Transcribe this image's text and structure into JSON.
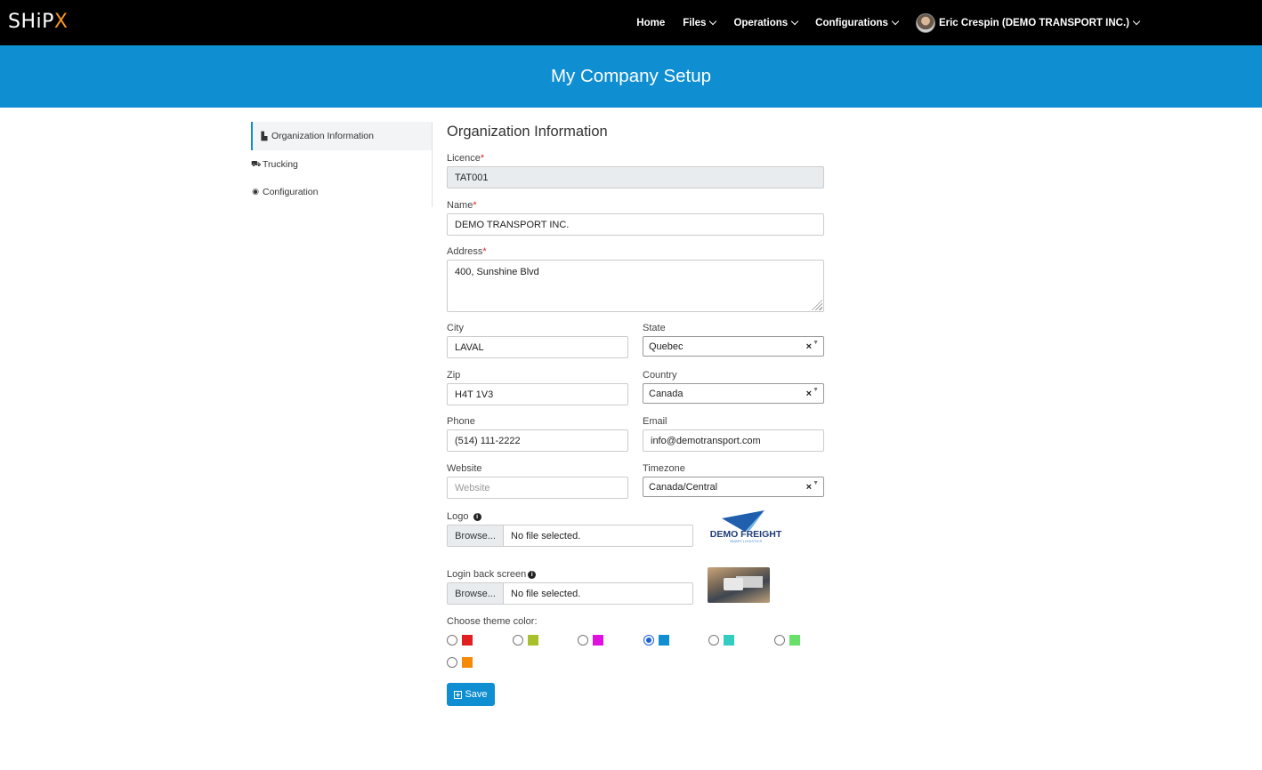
{
  "nav": {
    "brand_main": "SHiP",
    "brand_x": "X",
    "items": [
      {
        "label": "Home",
        "has_caret": false
      },
      {
        "label": "Files",
        "has_caret": true
      },
      {
        "label": "Operations",
        "has_caret": true
      },
      {
        "label": "Configurations",
        "has_caret": true
      }
    ],
    "user": "Eric Crespin (DEMO TRANSPORT INC.)"
  },
  "banner": {
    "title": "My Company Setup"
  },
  "sidebar": {
    "items": [
      {
        "label": "Organization Information",
        "icon": "building-icon",
        "active": true
      },
      {
        "label": "Trucking",
        "icon": "truck-icon",
        "active": false
      },
      {
        "label": "Configuration",
        "icon": "globe-icon",
        "active": false
      }
    ]
  },
  "form": {
    "title": "Organization Information",
    "licence": {
      "label": "Licence",
      "value": "TAT001"
    },
    "name": {
      "label": "Name",
      "value": "DEMO TRANSPORT INC."
    },
    "address": {
      "label": "Address",
      "value": "400, Sunshine Blvd"
    },
    "city": {
      "label": "City",
      "value": "LAVAL"
    },
    "state": {
      "label": "State",
      "value": "Quebec"
    },
    "zip": {
      "label": "Zip",
      "value": "H4T 1V3"
    },
    "country": {
      "label": "Country",
      "value": "Canada"
    },
    "phone": {
      "label": "Phone",
      "value": "(514) 111-2222"
    },
    "email": {
      "label": "Email",
      "value": "info@demotransport.com"
    },
    "website": {
      "label": "Website",
      "value": "",
      "placeholder": "Website"
    },
    "timezone": {
      "label": "Timezone",
      "value": "Canada/Central"
    },
    "logo": {
      "label": "Logo",
      "browse": "Browse...",
      "file": "No file selected.",
      "preview_text": "DEMO FREIGHT",
      "preview_sub": "SMART LOGISTICS"
    },
    "login_back": {
      "label": "Login back screen",
      "browse": "Browse...",
      "file": "No file selected."
    },
    "theme": {
      "label": "Choose theme color:",
      "colors": [
        "#e02020",
        "#a8c02a",
        "#e010e0",
        "#0f8ed1",
        "#33ccc0",
        "#66e066",
        "#f58a07"
      ],
      "selected_index": 3
    },
    "save_label": "Save"
  }
}
